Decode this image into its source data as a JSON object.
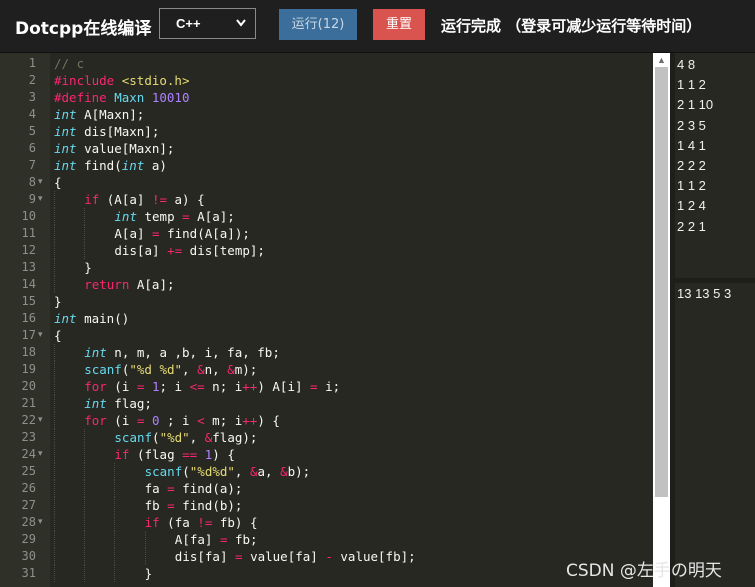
{
  "header": {
    "brand": "Dotcpp在线编译",
    "language": "C++",
    "run_label": "运行(12)",
    "reset_label": "重置",
    "status": "运行完成 （登录可减少运行等待时间）"
  },
  "editor": {
    "lines": [
      {
        "n": "1",
        "indent": 0,
        "fold": false,
        "t": [
          [
            "c-com",
            "// c"
          ]
        ]
      },
      {
        "n": "2",
        "indent": 0,
        "fold": false,
        "t": [
          [
            "c-pre",
            "#include"
          ],
          [
            "",
            " "
          ],
          [
            "c-str",
            "<stdio.h>"
          ]
        ]
      },
      {
        "n": "3",
        "indent": 0,
        "fold": false,
        "t": [
          [
            "c-pre",
            "#define"
          ],
          [
            "",
            " "
          ],
          [
            "c-fn",
            "Maxn"
          ],
          [
            "",
            " "
          ],
          [
            "c-num",
            "10010"
          ]
        ]
      },
      {
        "n": "4",
        "indent": 0,
        "fold": false,
        "t": [
          [
            "c-ty",
            "int"
          ],
          [
            "",
            " A[Maxn];"
          ]
        ]
      },
      {
        "n": "5",
        "indent": 0,
        "fold": false,
        "t": [
          [
            "c-ty",
            "int"
          ],
          [
            "",
            " dis[Maxn];"
          ]
        ]
      },
      {
        "n": "6",
        "indent": 0,
        "fold": false,
        "t": [
          [
            "c-ty",
            "int"
          ],
          [
            "",
            " value[Maxn];"
          ]
        ]
      },
      {
        "n": "7",
        "indent": 0,
        "fold": false,
        "t": [
          [
            "c-ty",
            "int"
          ],
          [
            "",
            " find("
          ],
          [
            "c-ty",
            "int"
          ],
          [
            "",
            " a)"
          ]
        ]
      },
      {
        "n": "8",
        "indent": 0,
        "fold": true,
        "t": [
          [
            "",
            "{"
          ]
        ]
      },
      {
        "n": "9",
        "indent": 1,
        "fold": true,
        "t": [
          [
            "c-kw",
            "if"
          ],
          [
            "",
            " (A[a] "
          ],
          [
            "c-op",
            "!="
          ],
          [
            "",
            " a) {"
          ]
        ]
      },
      {
        "n": "10",
        "indent": 2,
        "fold": false,
        "t": [
          [
            "c-ty",
            "int"
          ],
          [
            "",
            " temp "
          ],
          [
            "c-op",
            "="
          ],
          [
            "",
            " A[a];"
          ]
        ]
      },
      {
        "n": "11",
        "indent": 2,
        "fold": false,
        "t": [
          [
            "",
            "A[a] "
          ],
          [
            "c-op",
            "="
          ],
          [
            "",
            " find(A[a]);"
          ]
        ]
      },
      {
        "n": "12",
        "indent": 2,
        "fold": false,
        "t": [
          [
            "",
            "dis[a] "
          ],
          [
            "c-op",
            "+="
          ],
          [
            "",
            " dis[temp];"
          ]
        ]
      },
      {
        "n": "13",
        "indent": 1,
        "fold": false,
        "t": [
          [
            "",
            "}"
          ]
        ]
      },
      {
        "n": "14",
        "indent": 1,
        "fold": false,
        "t": [
          [
            "c-kw",
            "return"
          ],
          [
            "",
            " A[a];"
          ]
        ]
      },
      {
        "n": "15",
        "indent": 0,
        "fold": false,
        "t": [
          [
            "",
            "}"
          ]
        ]
      },
      {
        "n": "16",
        "indent": 0,
        "fold": false,
        "t": [
          [
            "c-ty",
            "int"
          ],
          [
            "",
            " main()"
          ]
        ]
      },
      {
        "n": "17",
        "indent": 0,
        "fold": true,
        "t": [
          [
            "",
            "{"
          ]
        ]
      },
      {
        "n": "18",
        "indent": 1,
        "fold": false,
        "t": [
          [
            "c-ty",
            "int"
          ],
          [
            "",
            " n, m, a ,b, i, fa, fb;"
          ]
        ]
      },
      {
        "n": "19",
        "indent": 1,
        "fold": false,
        "t": [
          [
            "c-fn",
            "scanf"
          ],
          [
            "",
            "("
          ],
          [
            "c-str",
            "\"%d %d\""
          ],
          [
            "",
            ", "
          ],
          [
            "c-op",
            "&"
          ],
          [
            "",
            "n, "
          ],
          [
            "c-op",
            "&"
          ],
          [
            "",
            "m);"
          ]
        ]
      },
      {
        "n": "20",
        "indent": 1,
        "fold": false,
        "t": [
          [
            "c-kw",
            "for"
          ],
          [
            "",
            " (i "
          ],
          [
            "c-op",
            "="
          ],
          [
            "",
            " "
          ],
          [
            "c-num",
            "1"
          ],
          [
            "",
            "; i "
          ],
          [
            "c-op",
            "<="
          ],
          [
            "",
            " n; i"
          ],
          [
            "c-op",
            "++"
          ],
          [
            "",
            ") A[i] "
          ],
          [
            "c-op",
            "="
          ],
          [
            "",
            " i;"
          ]
        ]
      },
      {
        "n": "21",
        "indent": 1,
        "fold": false,
        "t": [
          [
            "c-ty",
            "int"
          ],
          [
            "",
            " flag;"
          ]
        ]
      },
      {
        "n": "22",
        "indent": 1,
        "fold": true,
        "t": [
          [
            "c-kw",
            "for"
          ],
          [
            "",
            " (i "
          ],
          [
            "c-op",
            "="
          ],
          [
            "",
            " "
          ],
          [
            "c-num",
            "0"
          ],
          [
            "",
            " ; i "
          ],
          [
            "c-op",
            "<"
          ],
          [
            "",
            " m; i"
          ],
          [
            "c-op",
            "++"
          ],
          [
            "",
            ") {"
          ]
        ]
      },
      {
        "n": "23",
        "indent": 2,
        "fold": false,
        "t": [
          [
            "c-fn",
            "scanf"
          ],
          [
            "",
            "("
          ],
          [
            "c-str",
            "\"%d\""
          ],
          [
            "",
            ", "
          ],
          [
            "c-op",
            "&"
          ],
          [
            "",
            "flag);"
          ]
        ]
      },
      {
        "n": "24",
        "indent": 2,
        "fold": true,
        "t": [
          [
            "c-kw",
            "if"
          ],
          [
            "",
            " (flag "
          ],
          [
            "c-op",
            "=="
          ],
          [
            "",
            " "
          ],
          [
            "c-num",
            "1"
          ],
          [
            "",
            ") {"
          ]
        ]
      },
      {
        "n": "25",
        "indent": 3,
        "fold": false,
        "t": [
          [
            "c-fn",
            "scanf"
          ],
          [
            "",
            "("
          ],
          [
            "c-str",
            "\"%d%d\""
          ],
          [
            "",
            ", "
          ],
          [
            "c-op",
            "&"
          ],
          [
            "",
            "a, "
          ],
          [
            "c-op",
            "&"
          ],
          [
            "",
            "b);"
          ]
        ]
      },
      {
        "n": "26",
        "indent": 3,
        "fold": false,
        "t": [
          [
            "",
            "fa "
          ],
          [
            "c-op",
            "="
          ],
          [
            "",
            " find(a);"
          ]
        ]
      },
      {
        "n": "27",
        "indent": 3,
        "fold": false,
        "t": [
          [
            "",
            "fb "
          ],
          [
            "c-op",
            "="
          ],
          [
            "",
            " find(b);"
          ]
        ]
      },
      {
        "n": "28",
        "indent": 3,
        "fold": true,
        "t": [
          [
            "c-kw",
            "if"
          ],
          [
            "",
            " (fa "
          ],
          [
            "c-op",
            "!="
          ],
          [
            "",
            " fb) {"
          ]
        ]
      },
      {
        "n": "29",
        "indent": 4,
        "fold": false,
        "t": [
          [
            "",
            "A[fa] "
          ],
          [
            "c-op",
            "="
          ],
          [
            "",
            " fb;"
          ]
        ]
      },
      {
        "n": "30",
        "indent": 4,
        "fold": false,
        "t": [
          [
            "",
            "dis[fa] "
          ],
          [
            "c-op",
            "="
          ],
          [
            "",
            " value[fa] "
          ],
          [
            "c-op",
            "-"
          ],
          [
            "",
            " value[fb];"
          ]
        ]
      },
      {
        "n": "31",
        "indent": 3,
        "fold": false,
        "t": [
          [
            "",
            "}"
          ]
        ]
      }
    ]
  },
  "input": {
    "lines": [
      "4 8",
      "1 1 2",
      "2 1 10",
      "2 3 5",
      "1 4 1",
      "2 2 2",
      "1 1 2",
      "1 2 4",
      "2 2 1"
    ]
  },
  "output": {
    "lines": [
      "13 13 5 3"
    ]
  },
  "watermark": "CSDN @左手の明天",
  "colors": {
    "background": "#272822",
    "run_button": "#3b6e9a",
    "reset_button": "#d9534f"
  }
}
